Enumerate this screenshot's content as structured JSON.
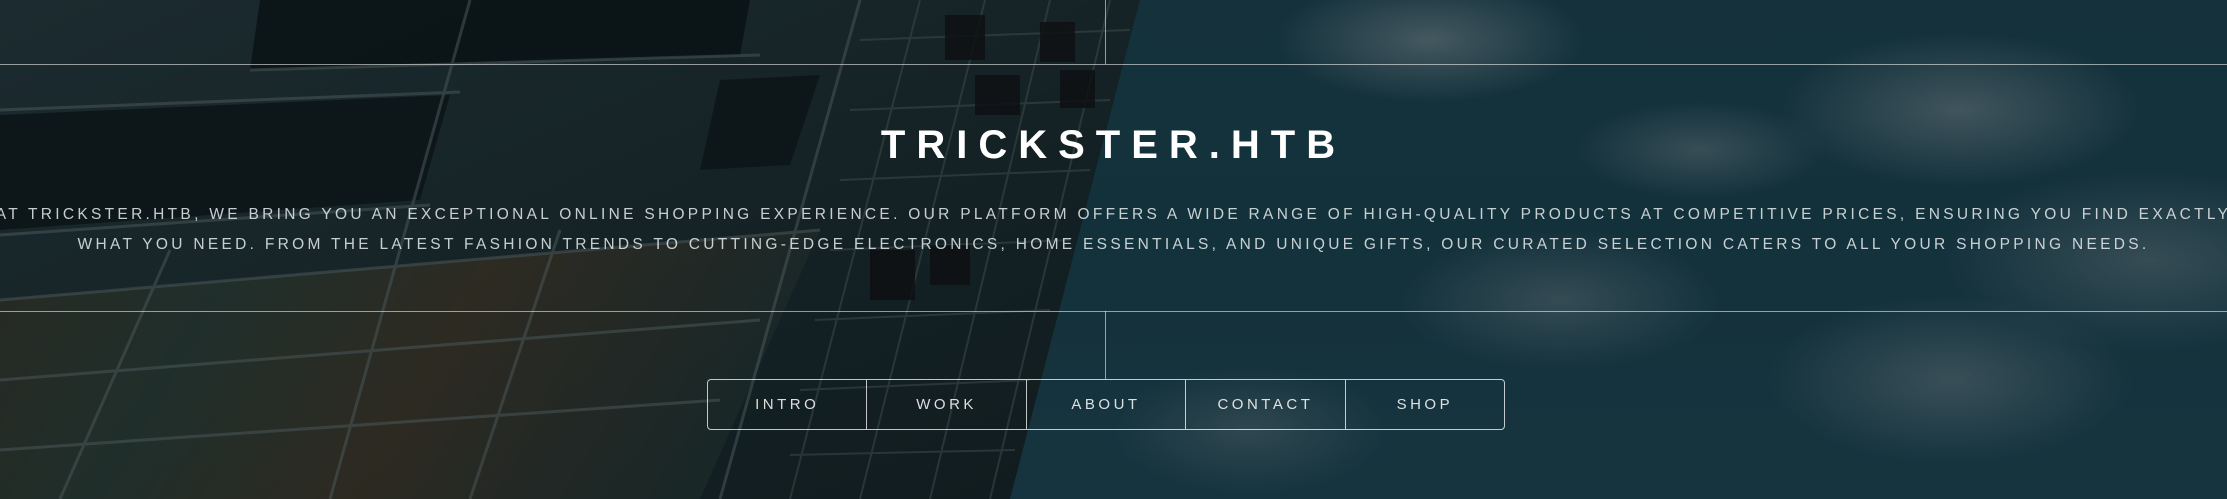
{
  "header": {
    "title": "TRICKSTER.HTB",
    "intro": "AT TRICKSTER.HTB, WE BRING YOU AN EXCEPTIONAL ONLINE SHOPPING EXPERIENCE. OUR PLATFORM OFFERS A WIDE RANGE OF HIGH-QUALITY PRODUCTS AT COMPETITIVE PRICES, ENSURING YOU FIND EXACTLY WHAT YOU NEED. FROM THE LATEST FASHION TRENDS TO CUTTING-EDGE ELECTRONICS, HOME ESSENTIALS, AND UNIQUE GIFTS, OUR CURATED SELECTION CATERS TO ALL YOUR SHOPPING NEEDS."
  },
  "nav": {
    "items": [
      {
        "label": "INTRO"
      },
      {
        "label": "WORK"
      },
      {
        "label": "ABOUT"
      },
      {
        "label": "CONTACT"
      },
      {
        "label": "SHOP"
      }
    ]
  },
  "colors": {
    "text": "#ffffff",
    "sky": "#1f4a57",
    "overlay": "#08161c"
  }
}
